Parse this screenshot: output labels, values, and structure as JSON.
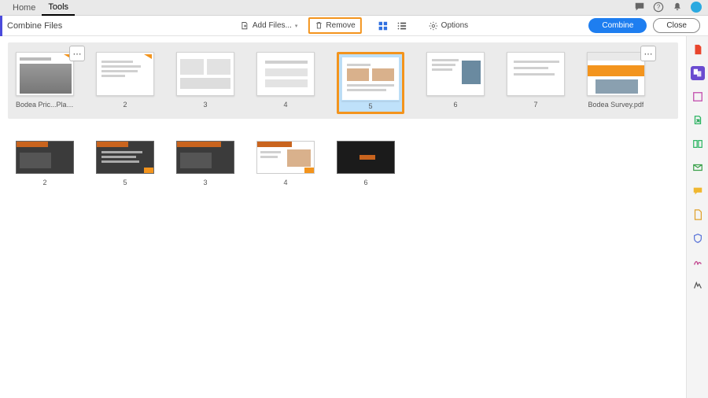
{
  "tabs": {
    "home": "Home",
    "tools": "Tools"
  },
  "toolbar": {
    "title": "Combine Files",
    "add_files": "Add Files...",
    "remove": "Remove",
    "options": "Options",
    "combine": "Combine",
    "close": "Close"
  },
  "row1": {
    "c0": "Bodea Pric...Plans.pptx",
    "c1": "2",
    "c2": "3",
    "c3": "4",
    "c4": "5",
    "c5": "6",
    "c6": "7",
    "c7": "Bodea Survey.pdf"
  },
  "row2": {
    "c0": "2",
    "c1": "5",
    "c2": "3",
    "c3": "4",
    "c4": "6"
  },
  "glyph": {
    "dots": "⋯",
    "caret": "▾"
  }
}
